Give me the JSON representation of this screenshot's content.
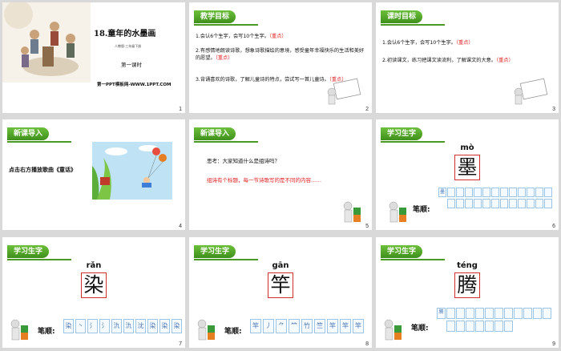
{
  "slides": [
    {
      "num": "1",
      "title": "18.童年的水墨画",
      "subtitle": "人教版·三年级下册",
      "lesson": "第一课时",
      "footer": "第一PPT模板网-WWW.1PPT.COM"
    },
    {
      "num": "2",
      "tag": "教学目标",
      "items": [
        {
          "text": "1.会认6个生字，会写10个生字。",
          "mark": "（重点）"
        },
        {
          "text": "2.有感情地朗读诗歌，想象诗歌描绘的意境，感受童年幸福快乐的生活和美好的愿望。",
          "mark": "（重点）"
        },
        {
          "text": "3.背诵喜欢的诗歌，了解儿童诗的特点，尝试写一首儿童诗。",
          "mark": "（重点）"
        }
      ]
    },
    {
      "num": "3",
      "tag": "课时目标",
      "items": [
        {
          "text": "1.会认6个生字，会写10个生字。",
          "mark": "（重点）"
        },
        {
          "text": "2.初读课文，练习把课文读流利，了解课文的大意。",
          "mark": "（重点）"
        }
      ]
    },
    {
      "num": "4",
      "tag": "新课导入",
      "text": "点击右方播放歌曲《童话》"
    },
    {
      "num": "5",
      "tag": "新课导入",
      "q": "思考：大家知道什么是组诗吗？",
      "a": "组诗有个标题，每一节诗歌写的是不同的内容……"
    },
    {
      "num": "6",
      "tag": "学习生字",
      "pinyin": "mò",
      "char": "墨",
      "stroke_label": "笔顺:"
    },
    {
      "num": "7",
      "tag": "学习生字",
      "pinyin": "rǎn",
      "char": "染",
      "stroke_label": "笔顺:",
      "strokes": [
        "染",
        "丶",
        "氵",
        "氵",
        "氿",
        "氿",
        "沈",
        "染",
        "染",
        "染"
      ]
    },
    {
      "num": "8",
      "tag": "学习生字",
      "pinyin": "gān",
      "char": "竿",
      "stroke_label": "笔顺:",
      "strokes": [
        "竿",
        "丿",
        "⺈",
        "𥫗",
        "竹",
        "竺",
        "竿",
        "竿",
        "竿"
      ]
    },
    {
      "num": "9",
      "tag": "学习生字",
      "pinyin": "téng",
      "char": "腾",
      "stroke_label": "笔顺:"
    }
  ]
}
